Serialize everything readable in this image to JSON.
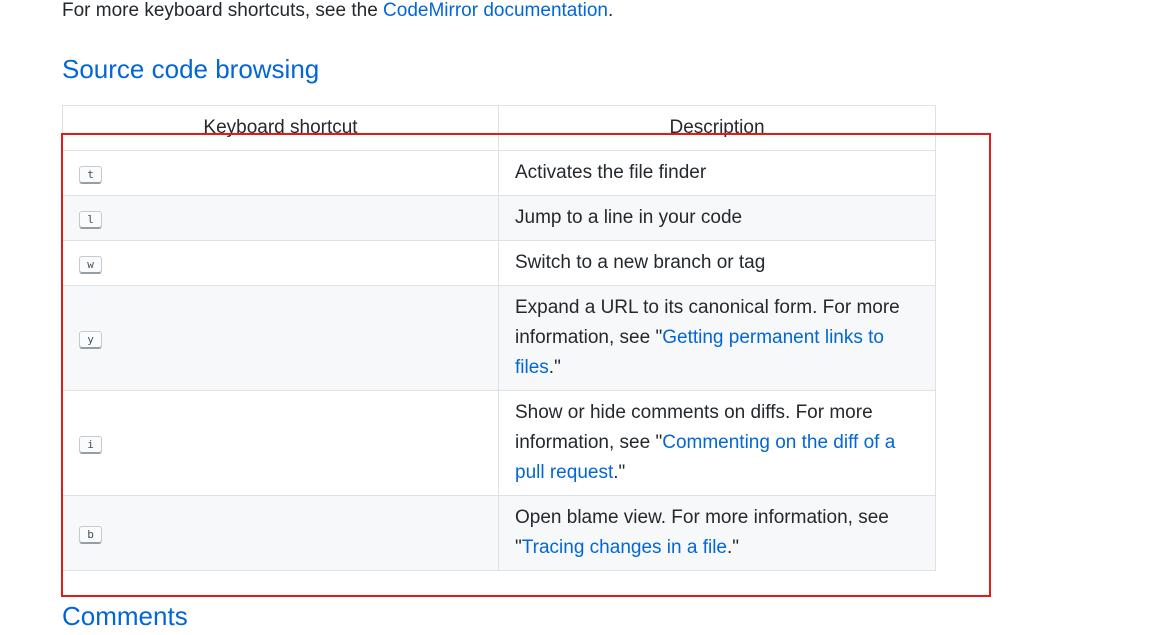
{
  "intro": {
    "text_before": "For more keyboard shortcuts, see the ",
    "link_label": "CodeMirror documentation",
    "text_after": "."
  },
  "section_title": "Source code browsing",
  "table": {
    "headers": [
      "Keyboard shortcut",
      "Description"
    ],
    "rows": [
      {
        "key": "t",
        "desc_before": "Activates the file finder",
        "link": "",
        "desc_after": ""
      },
      {
        "key": "l",
        "desc_before": "Jump to a line in your code",
        "link": "",
        "desc_after": ""
      },
      {
        "key": "w",
        "desc_before": "Switch to a new branch or tag",
        "link": "",
        "desc_after": ""
      },
      {
        "key": "y",
        "desc_before": "Expand a URL to its canonical form. For more information, see \"",
        "link": "Getting permanent links to files",
        "desc_after": ".\""
      },
      {
        "key": "i",
        "desc_before": "Show or hide comments on diffs. For more information, see \"",
        "link": "Commenting on the diff of a pull request",
        "desc_after": ".\""
      },
      {
        "key": "b",
        "desc_before": "Open blame view. For more information, see \"",
        "link": "Tracing changes in a file",
        "desc_after": ".\""
      }
    ]
  },
  "next_section_title": "Comments",
  "colors": {
    "link": "#0366d6",
    "highlight": "#e31a1a",
    "stripe": "#f6f8fa"
  }
}
